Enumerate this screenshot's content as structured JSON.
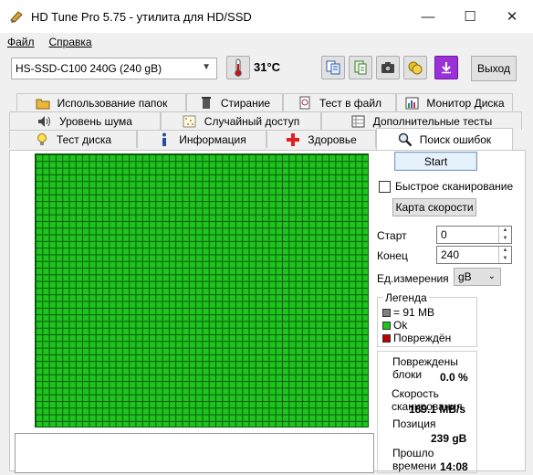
{
  "window": {
    "title": "HD Tune Pro 5.75 - утилита для HD/SSD",
    "minimize": "—",
    "maximize": "☐",
    "close": "✕"
  },
  "menu": {
    "file": "Файл",
    "help": "Справка"
  },
  "toolbar": {
    "drive": "HS-SSD-C100 240G (240 gB)",
    "temperature": "31°C",
    "exit_label": "Выход"
  },
  "tabs": {
    "row1": [
      "Использование папок",
      "Стирание",
      "Тест в файл",
      "Монитор Диска"
    ],
    "row2": [
      "Уровень шума",
      "Случайный доступ",
      "Дополнительные  тесты"
    ],
    "row3": [
      "Тест диска",
      "Информация",
      "Здоровье",
      "Поиск ошибок"
    ]
  },
  "controls": {
    "start_label": "Start",
    "quick_scan_label": "Быстрое сканирование",
    "speed_map_label": "Карта скорости",
    "start_pos_label": "Старт",
    "start_pos_value": "0",
    "end_pos_label": "Конец",
    "end_pos_value": "240",
    "unit_label": "Ед.измерения",
    "unit_value": "gB"
  },
  "legend": {
    "title": "Легенда",
    "block_size": "= 91 MB",
    "ok": "Ok",
    "damaged": "Повреждён"
  },
  "stats": {
    "damaged_blocks_label": "Повреждены блоки",
    "damaged_blocks_value": "0.0 %",
    "scan_speed_label": "Скорость сканирования",
    "scan_speed_value": "189.1 MB/s",
    "position_label": "Позиция",
    "position_value": "239 gB",
    "elapsed_label": "Прошло времени",
    "elapsed_value": "14:08"
  },
  "colors": {
    "ok_block": "#1ec31e",
    "size_block": "#808080",
    "damaged_block": "#c00000",
    "accent_purple": "#9b30d9"
  }
}
